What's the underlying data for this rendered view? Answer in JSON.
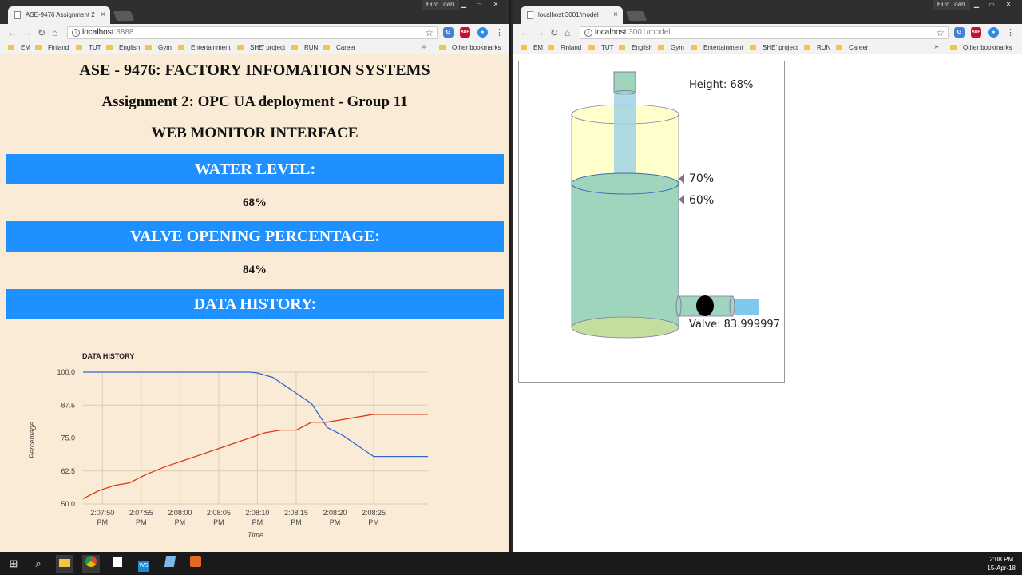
{
  "left_window": {
    "tab_title": "ASE-9476 Assignment 2",
    "url_host": "localhost",
    "url_rest": ":8888",
    "user": "Đức Toàn"
  },
  "right_window": {
    "tab_title": "localhost:3001/model",
    "url_host": "localhost",
    "url_rest": ":3001/model",
    "user": "Đức Toàn"
  },
  "bookmarks": [
    "EM",
    "Finland",
    "TUT",
    "English",
    "Gym",
    "Entertainment",
    "SHE' project",
    "RUN",
    "Career"
  ],
  "bookmarks_more": "»",
  "other_bookmarks": "Other bookmarks",
  "page": {
    "title1": "ASE - 9476: FACTORY INFOMATION SYSTEMS",
    "title2": "Assignment 2: OPC UA deployment - Group 11",
    "title3": "WEB MONITOR INTERFACE",
    "water_label": "WATER LEVEL:",
    "water_value": "68%",
    "valve_label": "VALVE OPENING PERCENTAGE:",
    "valve_value": "84%",
    "history_label": "DATA HISTORY:"
  },
  "chart_data": {
    "type": "line",
    "title": "DATA HISTORY",
    "xlabel": "Time",
    "ylabel": "Percentage",
    "ylim": [
      50,
      100
    ],
    "yticks": [
      "100.0",
      "87.5",
      "75.0",
      "62.5",
      "50.0"
    ],
    "xticks": [
      "2:07:50 PM",
      "2:07:55 PM",
      "2:08:00 PM",
      "2:08:05 PM",
      "2:08:10 PM",
      "2:08:15 PM",
      "2:08:20 PM",
      "2:08:25 PM"
    ],
    "xtick_seconds": [
      50,
      55,
      60,
      65,
      70,
      75,
      80,
      85
    ],
    "xlim_seconds": [
      47.5,
      92
    ],
    "grid": true,
    "series": [
      {
        "color": "#3366cc",
        "x": [
          47.5,
          52,
          56,
          60,
          64,
          68,
          69,
          70,
          72,
          74,
          75,
          77,
          79,
          81,
          83,
          85,
          88,
          92
        ],
        "y": [
          100,
          100,
          100,
          100,
          100,
          100,
          100,
          99.7,
          98,
          94,
          92,
          88,
          79,
          76,
          72,
          68,
          68,
          68
        ]
      },
      {
        "color": "#dc3912",
        "x": [
          47.5,
          49.5,
          51.5,
          53.5,
          55.5,
          58,
          61,
          64,
          66,
          69,
          71,
          73,
          75,
          77,
          79,
          81,
          85,
          88,
          92
        ],
        "y": [
          52,
          55,
          57,
          58,
          61,
          64,
          67,
          70,
          72,
          75,
          77,
          78,
          78,
          81,
          81,
          82,
          84,
          84,
          84
        ]
      }
    ]
  },
  "model": {
    "height_label": "Height: 68%",
    "mark_70": "70%",
    "mark_60": "60%",
    "valve_label": "Valve: 83.999997",
    "level_fraction": 0.68,
    "colors": {
      "water": "#9fd5bc",
      "tank_top": "#ffffcc",
      "inflow": "#a0d2e4",
      "outflow": "#7ec8ee",
      "outline": "#8a7ca8",
      "marker": "#8a6e8a"
    }
  },
  "taskbar": {
    "time": "2:08 PM",
    "date": "15-Apr-18"
  }
}
